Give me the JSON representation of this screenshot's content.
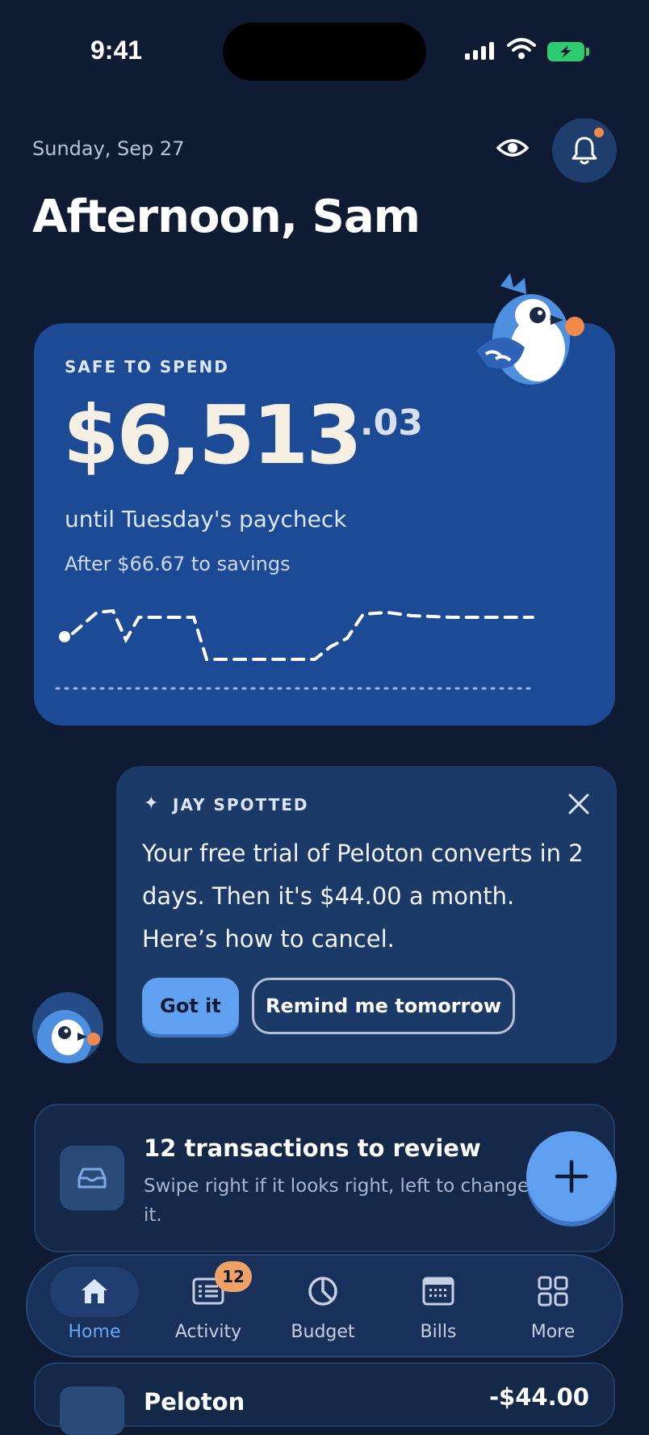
{
  "status_bar": {
    "time": "9:41"
  },
  "header": {
    "date": "Sunday, Sep 27",
    "greeting": "Afternoon, Sam"
  },
  "spend_card": {
    "label": "SAFE TO SPEND",
    "amount_main": "$6,513",
    "amount_cents": ".03",
    "until_text": "until Tuesday's paycheck",
    "after_text": "After $66.67 to savings"
  },
  "jay_card": {
    "label": "JAY SPOTTED",
    "message": "Your free trial of Peloton converts in 2 days. Then it's $44.00 a month. Here’s how to cancel.",
    "got_it": "Got it",
    "remind": "Remind me tomorrow"
  },
  "review_card": {
    "title": "12 transactions to review",
    "subtitle": "Swipe right if it looks right, left to change it."
  },
  "tabs": [
    {
      "label": "Home",
      "icon": "home-icon",
      "active": true
    },
    {
      "label": "Activity",
      "icon": "activity-icon",
      "badge": "12"
    },
    {
      "label": "Budget",
      "icon": "budget-icon"
    },
    {
      "label": "Bills",
      "icon": "bills-icon"
    },
    {
      "label": "More",
      "icon": "more-icon"
    }
  ],
  "peek_row": {
    "name": "Peloton",
    "amount": "-$44.00"
  },
  "colors": {
    "background": "#0f1b33",
    "spend_card": "#1d4a95",
    "accent": "#5fa0f0",
    "notification_dot": "#f08a4b",
    "badge": "#f0a266"
  }
}
